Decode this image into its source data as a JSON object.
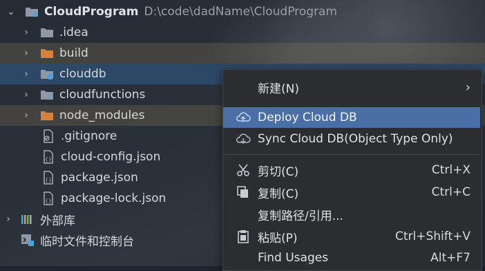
{
  "project": {
    "name": "CloudProgram",
    "path": "D:\\code\\dadName\\CloudProgram"
  },
  "tree": [
    {
      "label": "CloudProgram",
      "icon": "folder-icon"
    },
    {
      "label": ".idea",
      "icon": "folder-icon"
    },
    {
      "label": "build",
      "icon": "folder-orange-icon"
    },
    {
      "label": "clouddb",
      "icon": "folder-db-icon"
    },
    {
      "label": "cloudfunctions",
      "icon": "folder-function-icon"
    },
    {
      "label": "node_modules",
      "icon": "folder-orange-icon"
    },
    {
      "label": ".gitignore",
      "icon": "gitignore-file-icon"
    },
    {
      "label": "cloud-config.json",
      "icon": "json-file-icon"
    },
    {
      "label": "package.json",
      "icon": "json-file-icon"
    },
    {
      "label": "package-lock.json",
      "icon": "json-file-icon"
    },
    {
      "label": "外部库",
      "icon": "library-icon"
    },
    {
      "label": "临时文件和控制台",
      "icon": "scratches-icon"
    }
  ],
  "menu": {
    "items": [
      {
        "label": "新建(N)",
        "shortcut": ""
      },
      {
        "label": "Deploy Cloud DB",
        "shortcut": ""
      },
      {
        "label": "Sync Cloud DB(Object Type Only)",
        "shortcut": ""
      },
      {
        "label": "剪切(C)",
        "shortcut": "Ctrl+X"
      },
      {
        "label": "复制(C)",
        "shortcut": "Ctrl+C"
      },
      {
        "label": "复制路径/引用...",
        "shortcut": ""
      },
      {
        "label": "粘贴(P)",
        "shortcut": "Ctrl+Shift+V"
      },
      {
        "label": "Find Usages",
        "shortcut": "Alt+F7"
      }
    ]
  },
  "colors": {
    "selection": "#2d4866",
    "menu_active": "#4a6ea6",
    "folder": "#8e98a6",
    "folder_orange": "#d9803d"
  }
}
